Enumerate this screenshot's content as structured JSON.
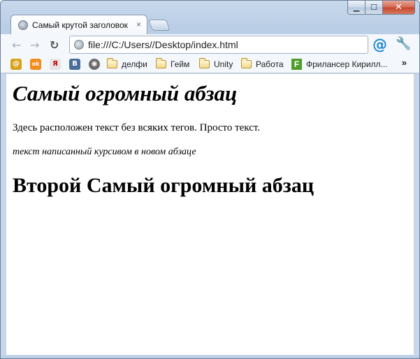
{
  "window": {
    "minimize_glyph": "▁",
    "maximize_glyph": "☐",
    "close_glyph": "✕"
  },
  "tabs": [
    {
      "title": "Самый крутой заголовок",
      "close_glyph": "×"
    }
  ],
  "toolbar": {
    "back_glyph": "←",
    "forward_glyph": "→",
    "reload_glyph": "↻",
    "url": "file:///C:/Users//Desktop/index.html",
    "at_glyph": "@",
    "wrench_glyph": "🔧"
  },
  "bookmarks": {
    "icons": [
      {
        "glyph": "@",
        "color": "#d8a21b",
        "icon": "mail-icon"
      },
      {
        "glyph": "ok",
        "color": "#f28c1e",
        "icon": "odnoklassniki-icon"
      },
      {
        "glyph": "Я",
        "color": "#e5e5e5",
        "icon": "yandex-icon"
      },
      {
        "glyph": "В",
        "color": "#4a6e9b",
        "icon": "vk-icon"
      },
      {
        "glyph": "◉",
        "color": "#6b6b6b",
        "icon": "media-icon"
      }
    ],
    "folders": [
      "делфи",
      "Гейм",
      "Unity",
      "Работа"
    ],
    "link_label": "Фрилансер Кирилл...",
    "more_glyph": "»"
  },
  "page": {
    "heading1": "Самый огромный абзац",
    "paragraph1": "Здесь расположен текст без всяких тегов. Просто текст.",
    "paragraph2": "текст написанный курсивом в новом абзаце",
    "heading2": "Второй Самый огромный абзац"
  }
}
